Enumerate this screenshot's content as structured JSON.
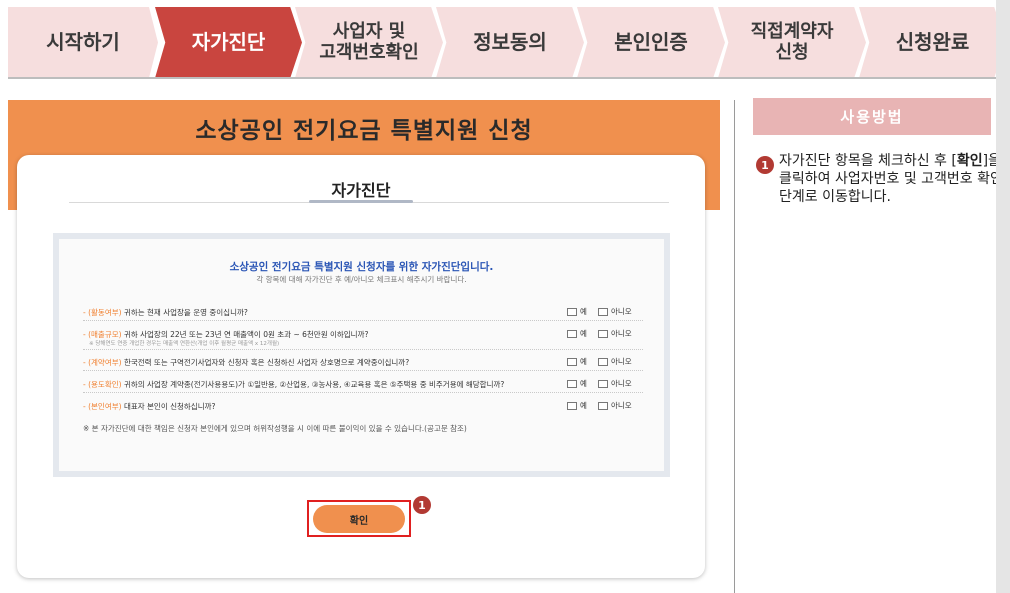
{
  "steps": [
    {
      "label": "시작하기",
      "state": "inactive"
    },
    {
      "label": "자가진단",
      "state": "active"
    },
    {
      "label_line1": "사업자 및",
      "label_line2": "고객번호확인",
      "state": "inactive"
    },
    {
      "label": "정보동의",
      "state": "inactive"
    },
    {
      "label": "본인인증",
      "state": "inactive"
    },
    {
      "label_line1": "직접계약자",
      "label_line2": "신청",
      "state": "inactive"
    },
    {
      "label": "신청완료",
      "state": "inactive"
    }
  ],
  "page": {
    "title": "소상공인 전기요금 특별지원 신청",
    "card_title": "자가진단"
  },
  "survey": {
    "heading": "소상공인 전기요금 특별지원 신청자를 위한 자가진단입니다.",
    "subheading": "각 항목에 대해 자가진단 후 예/아니오 체크표시 해주시기 바랍니다.",
    "yes_label": "예",
    "no_label": "아니오",
    "questions": [
      {
        "tag": "(활동여부)",
        "text": "귀하는 현재 사업장을 운영 중이십니까?",
        "note": ""
      },
      {
        "tag": "(매출규모)",
        "text": "귀하 사업장의 22년 또는 23년 연 매출액이 0원 초과 ~ 6천만원 이하입니까?",
        "note": "※ 당해연도 연중 개업한 경우는 매출액 연환산(개업 이후 월평균 매출액 x 12개월)"
      },
      {
        "tag": "(계약여부)",
        "text": "한국전력 또는 구역전기사업자와 신청자 혹은 신청하신 사업자 상호명으로 계약중이십니까?",
        "note": ""
      },
      {
        "tag": "(용도확인)",
        "text": "귀하의 사업장 계약종(전기사용용도)가 ①일반용, ②산업용, ③농사용, ④교육용 혹은 ⑤주택용 중 비주거용에 해당합니까?",
        "note": ""
      },
      {
        "tag": "(본인여부)",
        "text": "대표자 본인이 신청하십니까?",
        "note": ""
      }
    ],
    "footnote": "※ 본 자가진단에 대한 책임은 신청자 본인에게 있으며 허위작성행을 시 이에 따른 불이익이 있을 수 있습니다.(공고문 참조)",
    "confirm_label": "확인"
  },
  "marker": "1",
  "help": {
    "title": "사용방법",
    "marker": "1",
    "text_pre": "자가진단 항목을 체크하신 후 [",
    "text_bold": "확인",
    "text_post": "]을 클릭하여 사업자번호 및 고객번호 확인 단계로 이동합니다."
  },
  "colors": {
    "active_step": "#c9453f",
    "inactive_step": "#f6dede",
    "accent_orange": "#f0904e",
    "heading_blue": "#2a55b5",
    "help_box": "#e8b4b4",
    "marker": "#b23a33",
    "highlight": "#e02020"
  }
}
